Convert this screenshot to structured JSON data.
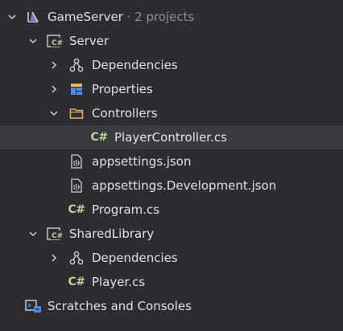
{
  "tree": {
    "solution": {
      "name": "GameServer",
      "suffix": " · 2 projects"
    },
    "server": {
      "name": "Server",
      "dependencies": "Dependencies",
      "properties": "Properties",
      "controllers": "Controllers",
      "player_controller": "PlayerController.cs",
      "appsettings": "appsettings.json",
      "appsettings_dev": "appsettings.Development.json",
      "program": "Program.cs"
    },
    "shared": {
      "name": "SharedLibrary",
      "dependencies": "Dependencies",
      "player": "Player.cs"
    },
    "scratches": "Scratches and Consoles",
    "cs_glyph": "C#"
  },
  "colors": {
    "background": "#2b2d30",
    "selected": "#393b40",
    "text": "#dfe1e5",
    "muted": "#8c8f94",
    "csharp": "#b9d59c",
    "folder": "#e8b55c",
    "properties": "#4a8ce8",
    "solution": "#9b7bd4"
  },
  "icons": {
    "solution": "visual-studio-solution-icon",
    "project": "csharp-project-icon",
    "dependencies": "dependencies-icon",
    "properties": "properties-icon",
    "folder": "folder-icon",
    "csharp_file": "csharp-file-icon",
    "json_file": "json-settings-icon",
    "scratches": "scratches-icon"
  }
}
